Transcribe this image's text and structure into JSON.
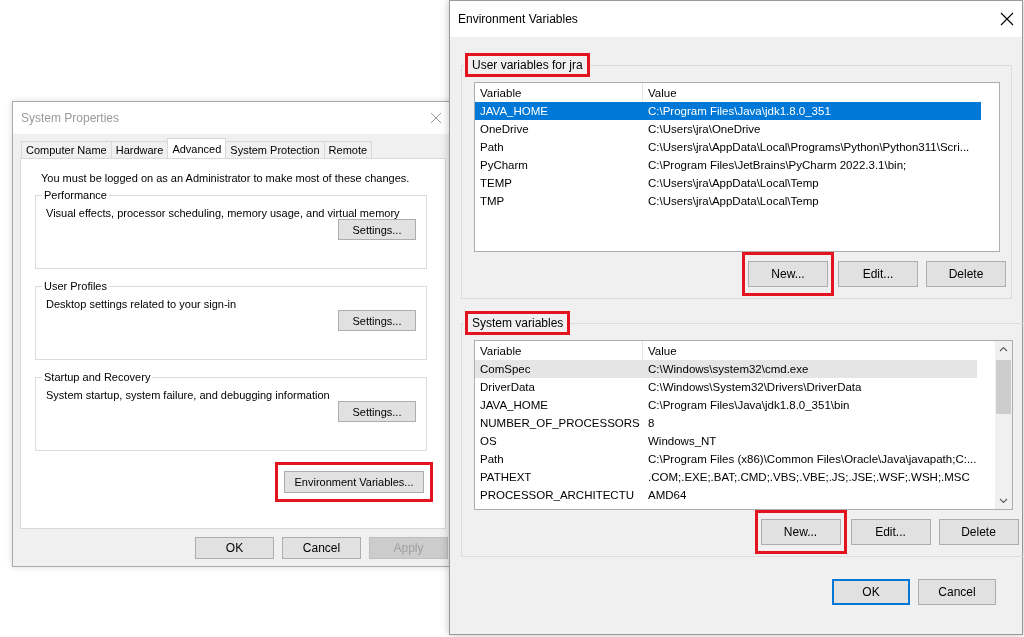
{
  "system_properties": {
    "title": "System Properties",
    "active": false,
    "tabs": [
      {
        "label": "Computer Name",
        "selected": false
      },
      {
        "label": "Hardware",
        "selected": false
      },
      {
        "label": "Advanced",
        "selected": true
      },
      {
        "label": "System Protection",
        "selected": false
      },
      {
        "label": "Remote",
        "selected": false
      }
    ],
    "notice": "You must be logged on as an Administrator to make most of these changes.",
    "groups": [
      {
        "title": "Performance",
        "description": "Visual effects, processor scheduling, memory usage, and virtual memory",
        "button": "Settings..."
      },
      {
        "title": "User Profiles",
        "description": "Desktop settings related to your sign-in",
        "button": "Settings..."
      },
      {
        "title": "Startup and Recovery",
        "description": "System startup, system failure, and debugging information",
        "button": "Settings..."
      }
    ],
    "env_button": {
      "label": "Environment Variables...",
      "highlighted": true
    },
    "buttons": [
      {
        "label": "OK",
        "disabled": false
      },
      {
        "label": "Cancel",
        "disabled": false
      },
      {
        "label": "Apply",
        "disabled": true
      }
    ]
  },
  "environment_variables": {
    "title": "Environment Variables",
    "active": true,
    "sections": [
      {
        "title": "User variables for jra",
        "highlighted": true,
        "focused": true,
        "columns": [
          "Variable",
          "Value"
        ],
        "rows": [
          {
            "name": "JAVA_HOME",
            "value": "C:\\Program Files\\Java\\jdk1.8.0_351",
            "selected": true
          },
          {
            "name": "OneDrive",
            "value": "C:\\Users\\jra\\OneDrive",
            "selected": false
          },
          {
            "name": "Path",
            "value": "C:\\Users\\jra\\AppData\\Local\\Programs\\Python\\Python311\\Scri...",
            "selected": false
          },
          {
            "name": "PyCharm",
            "value": "C:\\Program Files\\JetBrains\\PyCharm 2022.3.1\\bin;",
            "selected": false
          },
          {
            "name": "TEMP",
            "value": "C:\\Users\\jra\\AppData\\Local\\Temp",
            "selected": false
          },
          {
            "name": "TMP",
            "value": "C:\\Users\\jra\\AppData\\Local\\Temp",
            "selected": false
          }
        ],
        "buttons": [
          {
            "label": "New...",
            "highlighted": true
          },
          {
            "label": "Edit...",
            "highlighted": false
          },
          {
            "label": "Delete",
            "highlighted": false
          }
        ]
      },
      {
        "title": "System variables",
        "highlighted": true,
        "focused": false,
        "columns": [
          "Variable",
          "Value"
        ],
        "rows": [
          {
            "name": "ComSpec",
            "value": "C:\\Windows\\system32\\cmd.exe",
            "selected": true
          },
          {
            "name": "DriverData",
            "value": "C:\\Windows\\System32\\Drivers\\DriverData",
            "selected": false
          },
          {
            "name": "JAVA_HOME",
            "value": "C:\\Program Files\\Java\\jdk1.8.0_351\\bin",
            "selected": false
          },
          {
            "name": "NUMBER_OF_PROCESSORS",
            "value": "8",
            "selected": false
          },
          {
            "name": "OS",
            "value": "Windows_NT",
            "selected": false
          },
          {
            "name": "Path",
            "value": "C:\\Program Files (x86)\\Common Files\\Oracle\\Java\\javapath;C:...",
            "selected": false
          },
          {
            "name": "PATHEXT",
            "value": ".COM;.EXE;.BAT;.CMD;.VBS;.VBE;.JS;.JSE;.WSF;.WSH;.MSC",
            "selected": false
          },
          {
            "name": "PROCESSOR_ARCHITECTU",
            "value": "AMD64",
            "selected": false
          }
        ],
        "buttons": [
          {
            "label": "New...",
            "highlighted": true
          },
          {
            "label": "Edit...",
            "highlighted": false
          },
          {
            "label": "Delete",
            "highlighted": false
          }
        ]
      }
    ],
    "buttons": [
      {
        "label": "OK",
        "default": true
      },
      {
        "label": "Cancel",
        "default": false
      }
    ]
  }
}
